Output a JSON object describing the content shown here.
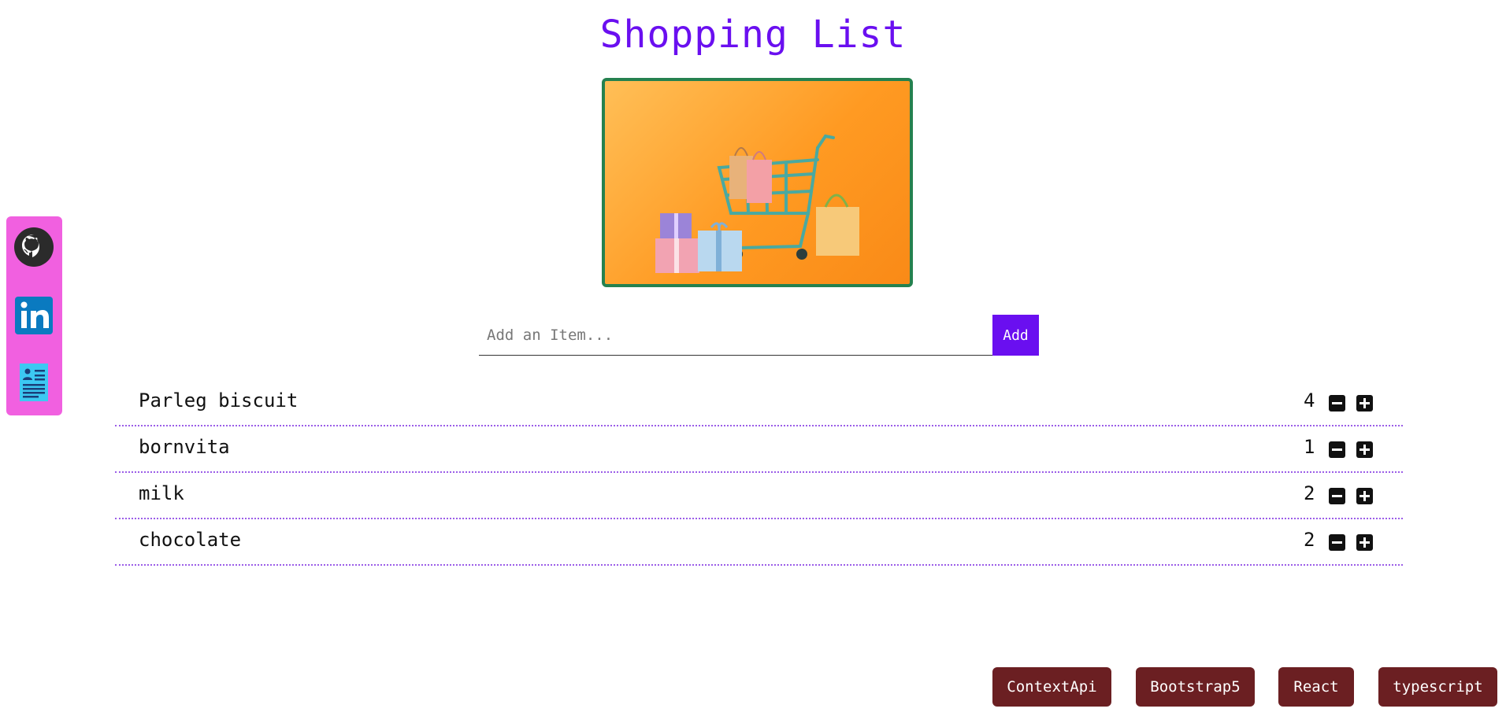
{
  "page": {
    "title": "Shopping List"
  },
  "hero": {
    "image": "shopping-cart-with-gifts-illustration"
  },
  "sidebar": {
    "items": [
      {
        "icon": "github-icon"
      },
      {
        "icon": "linkedin-icon"
      },
      {
        "icon": "resume-icon"
      }
    ]
  },
  "add_form": {
    "placeholder": "Add an Item...",
    "button_label": "Add"
  },
  "items": [
    {
      "name": "Parleg biscuit",
      "qty": "4"
    },
    {
      "name": "bornvita",
      "qty": "1"
    },
    {
      "name": "milk",
      "qty": "2"
    },
    {
      "name": "chocolate",
      "qty": "2"
    }
  ],
  "tags": [
    "ContextApi",
    "Bootstrap5",
    "React",
    "typescript"
  ],
  "colors": {
    "accent": "#6a0ff0",
    "sidebar": "#f160e0",
    "tag": "#6b1f22",
    "image_border": "#25814f"
  }
}
